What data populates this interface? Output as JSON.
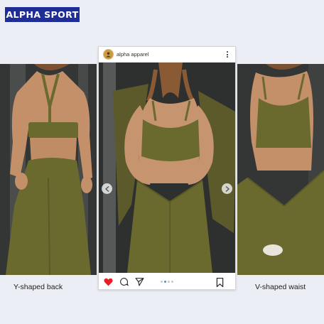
{
  "brand": {
    "name": "ALPHA SPORT"
  },
  "post": {
    "username": "alpha apparel",
    "carousel": {
      "dot_count": 4,
      "active_dot": 1
    }
  },
  "captions": {
    "left": "Y-shaped back",
    "right": "V-shaped waist"
  },
  "colors": {
    "brand_bg": "#1f2d96",
    "olive": "#6b6a2e",
    "like_red": "#ed1c24",
    "dot_active": "#3897f0"
  },
  "icons": [
    "heart-icon",
    "comment-icon",
    "share-icon",
    "bookmark-icon",
    "more-icon",
    "chevron-left-icon",
    "chevron-right-icon"
  ]
}
